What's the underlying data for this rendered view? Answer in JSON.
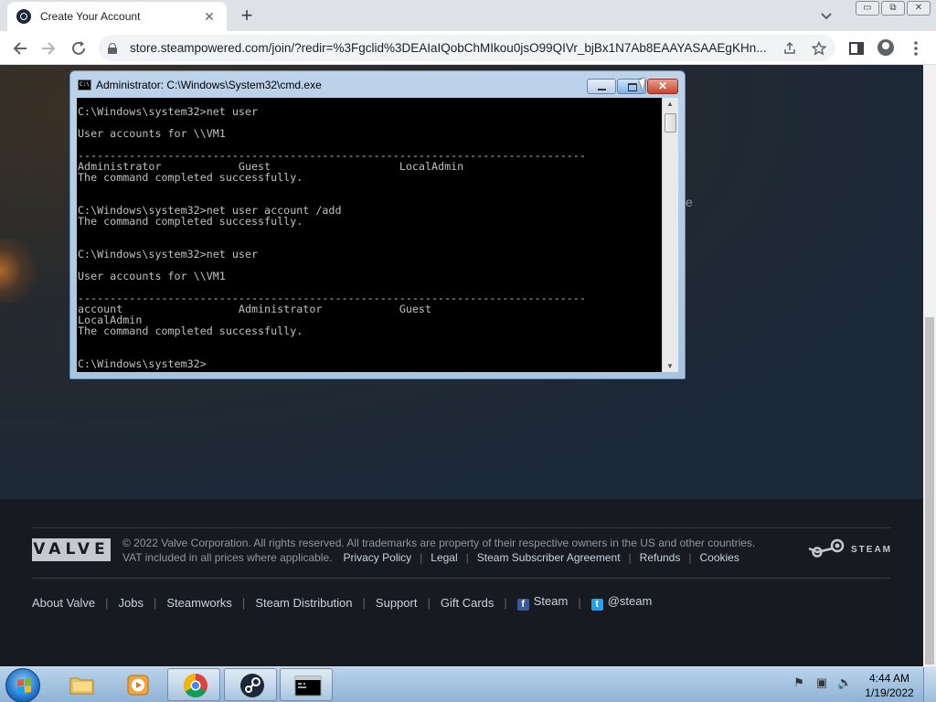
{
  "browser": {
    "tab_title": "Create Your Account",
    "tab_close": "✕",
    "new_tab": "+",
    "url": "store.steampowered.com/join/?redir=%3Fgclid%3DEAIaIQobChMIkou0jsO99QIVr_bjBx1N7Ab8EAAYASAAEgKHn...",
    "window_controls": [
      "▭",
      "⧉",
      "✕"
    ]
  },
  "page": {
    "partial_text": "e"
  },
  "cmd": {
    "title": "Administrator: C:\\Windows\\System32\\cmd.exe",
    "close_label": "✕",
    "lines": [
      "C:\\Windows\\system32>net user",
      "",
      "User accounts for \\\\VM1",
      "",
      "-------------------------------------------------------------------------------",
      "Administrator            Guest                    LocalAdmin",
      "The command completed successfully.",
      "",
      "",
      "C:\\Windows\\system32>net user account /add",
      "The command completed successfully.",
      "",
      "",
      "C:\\Windows\\system32>net user",
      "",
      "User accounts for \\\\VM1",
      "",
      "-------------------------------------------------------------------------------",
      "account                  Administrator            Guest",
      "LocalAdmin",
      "The command completed successfully.",
      "",
      "",
      "C:\\Windows\\system32>"
    ]
  },
  "footer": {
    "valve_logo": "VALVE",
    "copyright": "© 2022 Valve Corporation. All rights reserved. All trademarks are property of their respective owners in the US and other countries.",
    "vat": "VAT included in all prices where applicable.",
    "legal_links": [
      "Privacy Policy",
      "Legal",
      "Steam Subscriber Agreement",
      "Refunds",
      "Cookies"
    ],
    "steam_logo_text": "STEAM",
    "links": [
      "About Valve",
      "Jobs",
      "Steamworks",
      "Steam Distribution",
      "Support",
      "Gift Cards"
    ],
    "facebook": "Steam",
    "twitter": "@steam",
    "facebook_glyph": "f",
    "twitter_glyph": "t"
  },
  "taskbar": {
    "time": "4:44 AM",
    "date": "1/19/2022"
  },
  "colors": {
    "steam_bg": "#1b2838",
    "footer_bg": "#171a21",
    "link": "#c6d4df"
  }
}
